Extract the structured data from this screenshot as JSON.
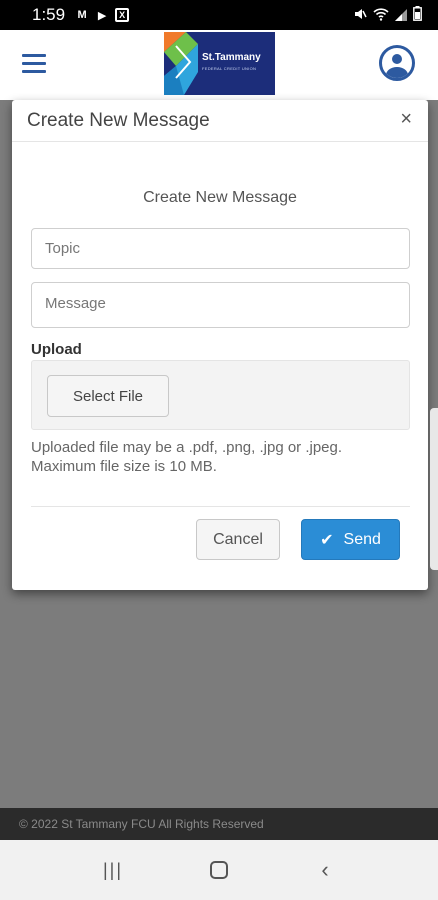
{
  "status_bar": {
    "time": "1:59",
    "left_icons": [
      "M",
      "▶",
      "X"
    ],
    "right_icons": [
      "mute-icon",
      "wifi-icon",
      "signal-icon",
      "battery-icon"
    ]
  },
  "header": {
    "logo_text": "St.Tammany",
    "logo_subtext": "FEDERAL CREDIT UNION"
  },
  "modal": {
    "title": "Create New Message",
    "close_label": "×",
    "form_heading": "Create New Message",
    "topic_placeholder": "Topic",
    "message_placeholder": "Message",
    "upload_label": "Upload",
    "select_file_label": "Select File",
    "help_text_line1": "Uploaded file may be a .pdf, .png, .jpg or .jpeg.",
    "help_text_line2": "Maximum file size is 10 MB.",
    "cancel_label": "Cancel",
    "send_label": "Send"
  },
  "footer": {
    "copyright": "© 2022 St Tammany FCU All Rights Reserved"
  },
  "colors": {
    "accent": "#2b8dd6",
    "brand": "#1c2d7a",
    "icon_blue": "#2d5aa0"
  }
}
